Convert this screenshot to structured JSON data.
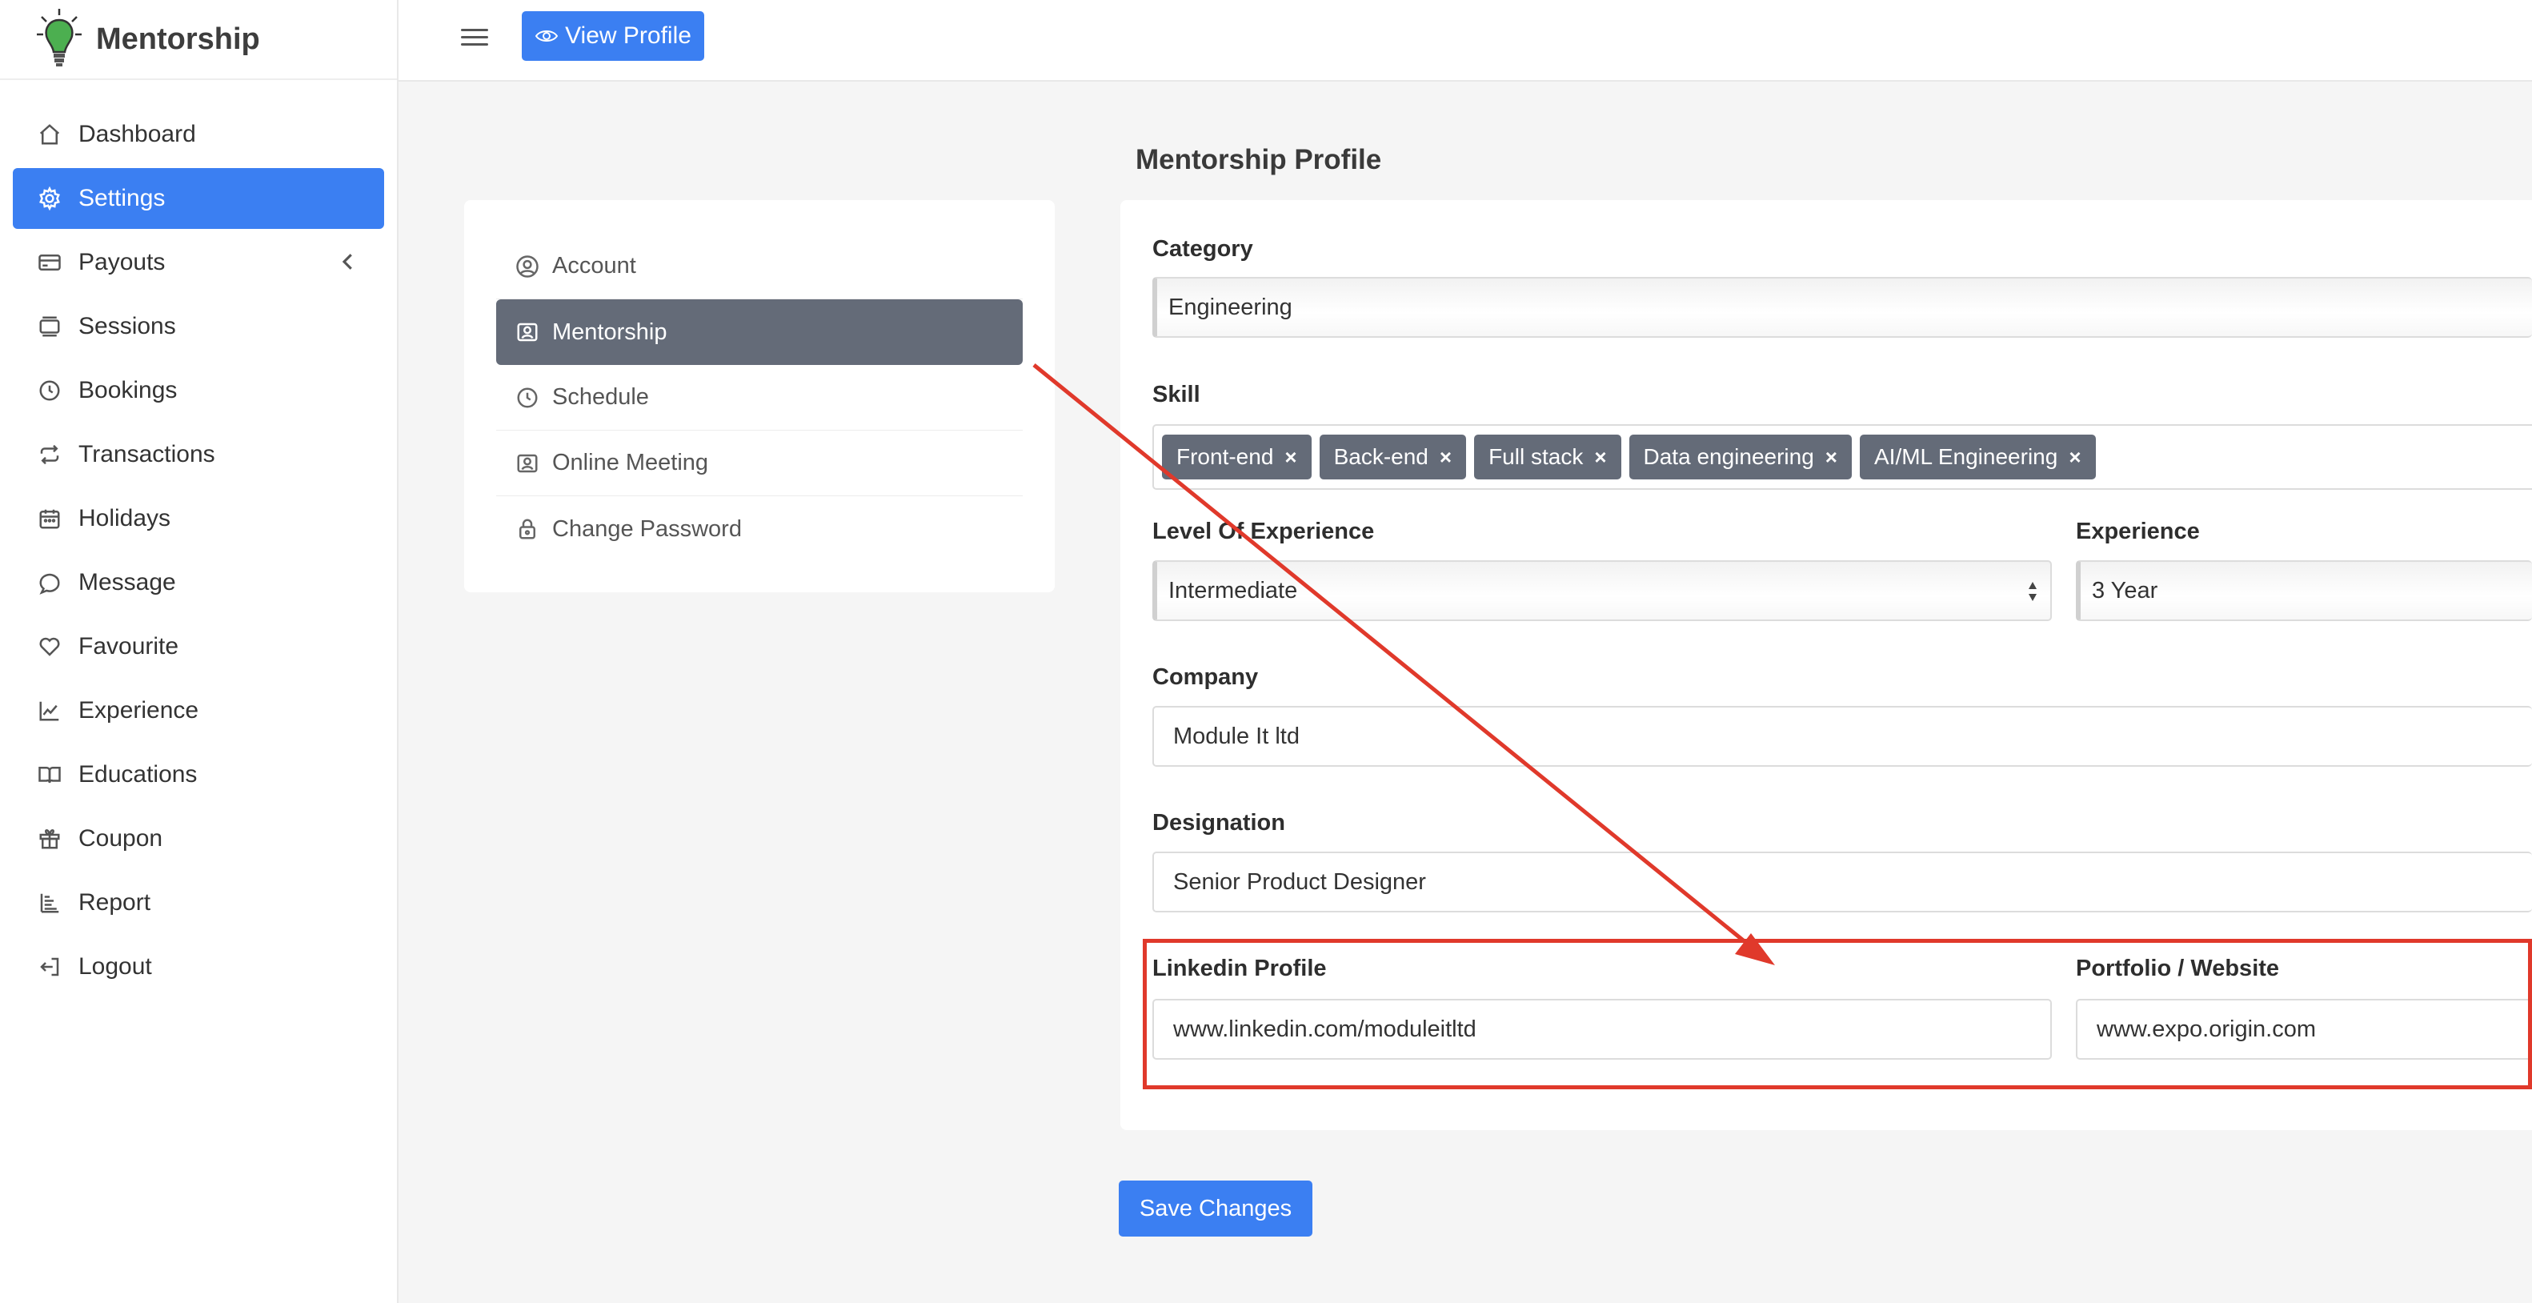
{
  "brand": {
    "name": "Mentorship",
    "logo_icon": "lightbulb-icon"
  },
  "header": {
    "view_profile_label": "View Profile"
  },
  "sidebar": {
    "items": [
      {
        "label": "Dashboard",
        "icon": "home-icon"
      },
      {
        "label": "Settings",
        "icon": "gear-icon",
        "active": true
      },
      {
        "label": "Payouts",
        "icon": "credit-card-icon",
        "has_submenu": true
      },
      {
        "label": "Sessions",
        "icon": "sessions-icon"
      },
      {
        "label": "Bookings",
        "icon": "clock-icon"
      },
      {
        "label": "Transactions",
        "icon": "repeat-icon"
      },
      {
        "label": "Holidays",
        "icon": "calendar-icon"
      },
      {
        "label": "Message",
        "icon": "chat-icon"
      },
      {
        "label": "Favourite",
        "icon": "heart-icon"
      },
      {
        "label": "Experience",
        "icon": "chart-line-icon"
      },
      {
        "label": "Educations",
        "icon": "book-icon"
      },
      {
        "label": "Coupon",
        "icon": "gift-icon"
      },
      {
        "label": "Report",
        "icon": "report-icon"
      },
      {
        "label": "Logout",
        "icon": "logout-icon"
      }
    ]
  },
  "settings_menu": {
    "items": [
      {
        "label": "Account",
        "icon": "user-circle-icon"
      },
      {
        "label": "Mentorship",
        "icon": "id-card-icon",
        "active": true
      },
      {
        "label": "Schedule",
        "icon": "clock-icon"
      },
      {
        "label": "Online Meeting",
        "icon": "id-card-icon"
      },
      {
        "label": "Change Password",
        "icon": "lock-icon"
      }
    ]
  },
  "form": {
    "title": "Mentorship Profile",
    "category": {
      "label": "Category",
      "value": "Engineering"
    },
    "skill": {
      "label": "Skill",
      "tags": [
        "Front-end",
        "Back-end",
        "Full stack",
        "Data engineering",
        "AI/ML Engineering"
      ]
    },
    "level": {
      "label": "Level Of Experience",
      "value": "Intermediate"
    },
    "experience": {
      "label": "Experience",
      "value": "3 Year"
    },
    "company": {
      "label": "Company",
      "value": "Module It ltd"
    },
    "designation": {
      "label": "Designation",
      "value": "Senior Product Designer"
    },
    "linkedin": {
      "label": "Linkedin Profile",
      "value": "www.linkedin.com/moduleitltd"
    },
    "portfolio": {
      "label": "Portfolio / Website",
      "value": "www.expo.origin.com"
    },
    "save_label": "Save Changes"
  },
  "colors": {
    "accent": "#3b7ff2",
    "submenu_active": "#646b78",
    "annotation": "#e0392b"
  }
}
